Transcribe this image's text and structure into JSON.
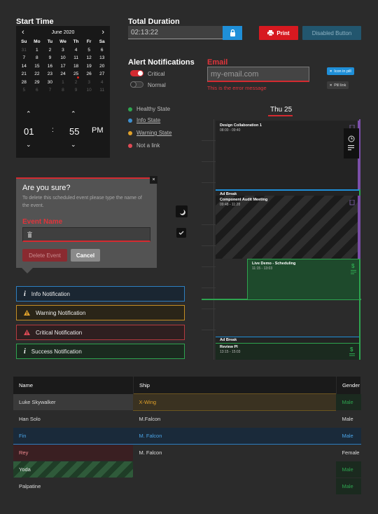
{
  "start_time": {
    "heading": "Start Time",
    "month_label": "June 2020",
    "prev": "‹",
    "next": "›",
    "weekdays": [
      "Su",
      "Mo",
      "Tu",
      "We",
      "Th",
      "Fr",
      "Sa"
    ],
    "weeks": [
      [
        "31",
        "1",
        "2",
        "3",
        "4",
        "5",
        "6"
      ],
      [
        "7",
        "8",
        "9",
        "10",
        "11",
        "12",
        "13"
      ],
      [
        "14",
        "15",
        "16",
        "17",
        "18",
        "19",
        "20"
      ],
      [
        "21",
        "22",
        "23",
        "24",
        "25",
        "26",
        "27"
      ],
      [
        "28",
        "29",
        "30",
        "1",
        "2",
        "3",
        "4"
      ],
      [
        "5",
        "6",
        "7",
        "8",
        "9",
        "10",
        "11"
      ]
    ],
    "hour": "01",
    "separator": ":",
    "minute": "55",
    "period": "PM",
    "up": "⌃",
    "down": "⌄"
  },
  "duration": {
    "heading": "Total Duration",
    "value": "02:13:22"
  },
  "buttons": {
    "print": "Print",
    "disabled": "Disabled Button"
  },
  "alerts": {
    "heading": "Alert Notifications",
    "critical": "Critical",
    "normal": "Normal"
  },
  "email": {
    "label": "Email",
    "placeholder": "my-email.com",
    "error": "This is the error message"
  },
  "pills": {
    "icon_pill": "Icon in pill",
    "pill_link": "Pill link"
  },
  "states": {
    "healthy": "Healthy State",
    "info": "Info State",
    "warning": "Warning State",
    "link": "Not a link"
  },
  "modal": {
    "title": "Are you sure?",
    "body": "To delete this scheduled event please type the name of the event.",
    "field_label": "Event Name",
    "delete": "Delete Event",
    "cancel": "Cancel",
    "close": "×"
  },
  "notifications": [
    {
      "text": "Info Notification",
      "icon": "i"
    },
    {
      "text": "Warning Notification",
      "icon": "!"
    },
    {
      "text": "Critical Notification",
      "icon": "!"
    },
    {
      "text": "Success Notification",
      "icon": "i"
    }
  ],
  "schedule": {
    "day_label": "Thu 25",
    "events": [
      {
        "title": "Design Collaboration 1",
        "time": "08:00 - 09:40"
      },
      {
        "title": "Ad Break",
        "time": ""
      },
      {
        "title": "Component Audit Meeting",
        "time": "09:48 - 11:28"
      },
      {
        "title": "Live Demo - Scheduling",
        "time": "11:15 - 13:03"
      },
      {
        "title": "Ad Break",
        "time": ""
      },
      {
        "title": "Review PI",
        "time": "13:15 - 15:03"
      }
    ]
  },
  "table": {
    "headers": [
      "Name",
      "Ship",
      "Gender"
    ],
    "rows": [
      [
        "Luke Skywalker",
        "X-Wing",
        "Male"
      ],
      [
        "Han Solo",
        "M.Falcon",
        "Male"
      ],
      [
        "Fin",
        "M. Falcon",
        "Male"
      ],
      [
        "Rey",
        "M. Falcon",
        "Female"
      ],
      [
        "Yoda",
        "",
        "Male"
      ],
      [
        "Palpatine",
        "",
        "Male"
      ]
    ]
  },
  "colors": {
    "accent_blue": "#1f8fd8",
    "critical_red": "#d71920",
    "success_green": "#2ea44f",
    "warning_yellow": "#e0a12a"
  }
}
